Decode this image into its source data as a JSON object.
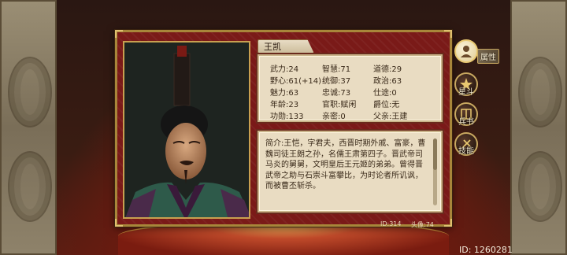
{
  "character": {
    "name": "王凯",
    "stats": [
      [
        "武力:24",
        "智慧:71",
        "道德:29"
      ],
      [
        "野心:61(+14)",
        "统御:37",
        "政治:63"
      ],
      [
        "魅力:63",
        "忠诚:73",
        "仕途:0"
      ],
      [
        "年龄:23",
        "官职:赋闲",
        "爵位:无"
      ],
      [
        "功勋:133",
        "亲密:0",
        "父亲:王建"
      ]
    ],
    "bio": "简介:王恺，字君夫，西晋时期外戚、富豪，曹魏司徒王朗之孙，名儒王肃第四子。晋武帝司马炎的舅舅，文明皇后王元姬的弟弟。曾得晋武帝之助与石崇斗富攀比，为时论者所讥讽，而被曹丕斩杀。",
    "id_label": "ID:314",
    "portrait_label": "头像:74"
  },
  "tabs": [
    {
      "label": "属性",
      "icon": "person-icon",
      "active": true
    },
    {
      "label": "星斗",
      "icon": "star-icon",
      "active": false
    },
    {
      "label": "兵书",
      "icon": "book-icon",
      "active": false
    },
    {
      "label": "技能",
      "icon": "skill-icon",
      "active": false
    }
  ],
  "user_id": "ID: 1260281",
  "colors": {
    "frame": "#7a1a18",
    "gold": "#a8863a",
    "parchment": "#e9dcc2"
  }
}
